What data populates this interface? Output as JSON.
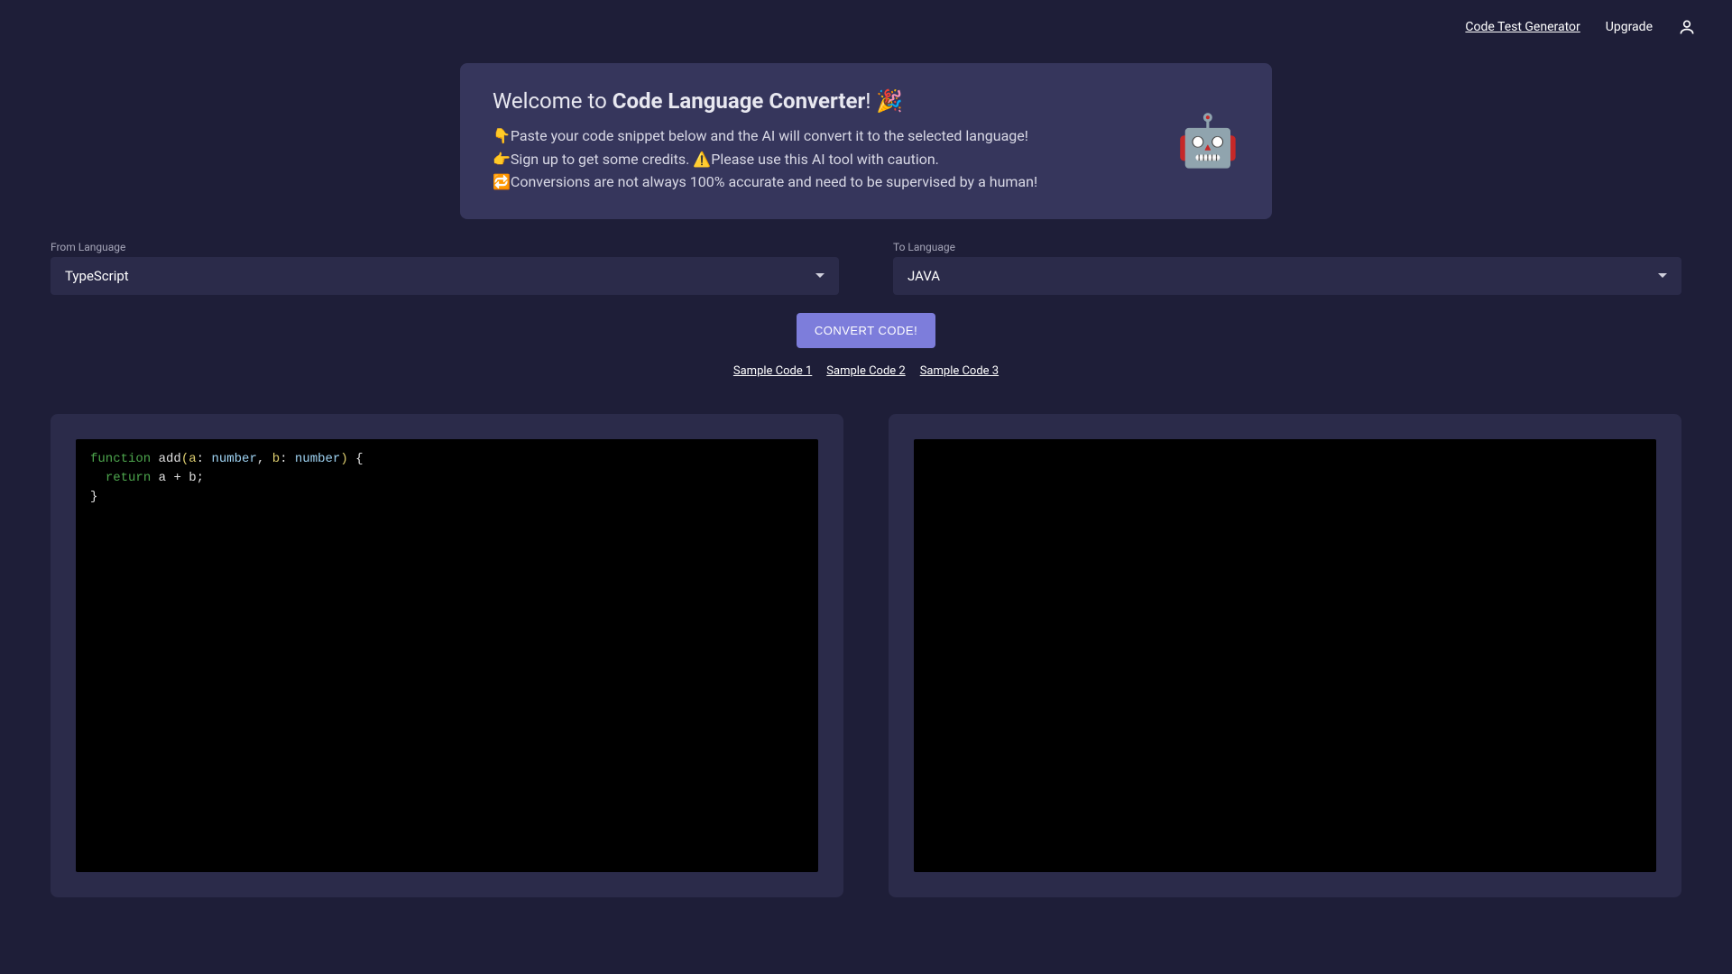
{
  "header": {
    "nav": {
      "code_test_generator": "Code Test Generator",
      "upgrade": "Upgrade"
    }
  },
  "welcome": {
    "title_prefix": "Welcome to ",
    "title_bold": "Code Language Converter",
    "title_suffix": "! 🎉",
    "line1": "👇Paste your code snippet below and the AI will convert it to the selected language!",
    "line2": "👉Sign up to get some credits. ⚠️Please use this AI tool with caution.",
    "line3": "🔁Conversions are not always 100% accurate and need to be supervised by a human!",
    "robot": "🤖"
  },
  "selects": {
    "from": {
      "label": "From Language",
      "value": "TypeScript"
    },
    "to": {
      "label": "To Language",
      "value": "JAVA"
    }
  },
  "convert_button": "CONVERT CODE!",
  "samples": {
    "s1": "Sample Code 1",
    "s2": "Sample Code 2",
    "s3": "Sample Code 3"
  },
  "code": {
    "source": {
      "tokens": {
        "t1": "function",
        "t2": " add",
        "t3": "(",
        "t4": "a",
        "t5": ": ",
        "t6": "number",
        "t7": ", ",
        "t8": "b",
        "t9": ": ",
        "t10": "number",
        "t11": ")",
        "t12": " {",
        "t13": "  ",
        "t14": "return",
        "t15": " a + b;",
        "t16": "}"
      }
    },
    "output": ""
  }
}
